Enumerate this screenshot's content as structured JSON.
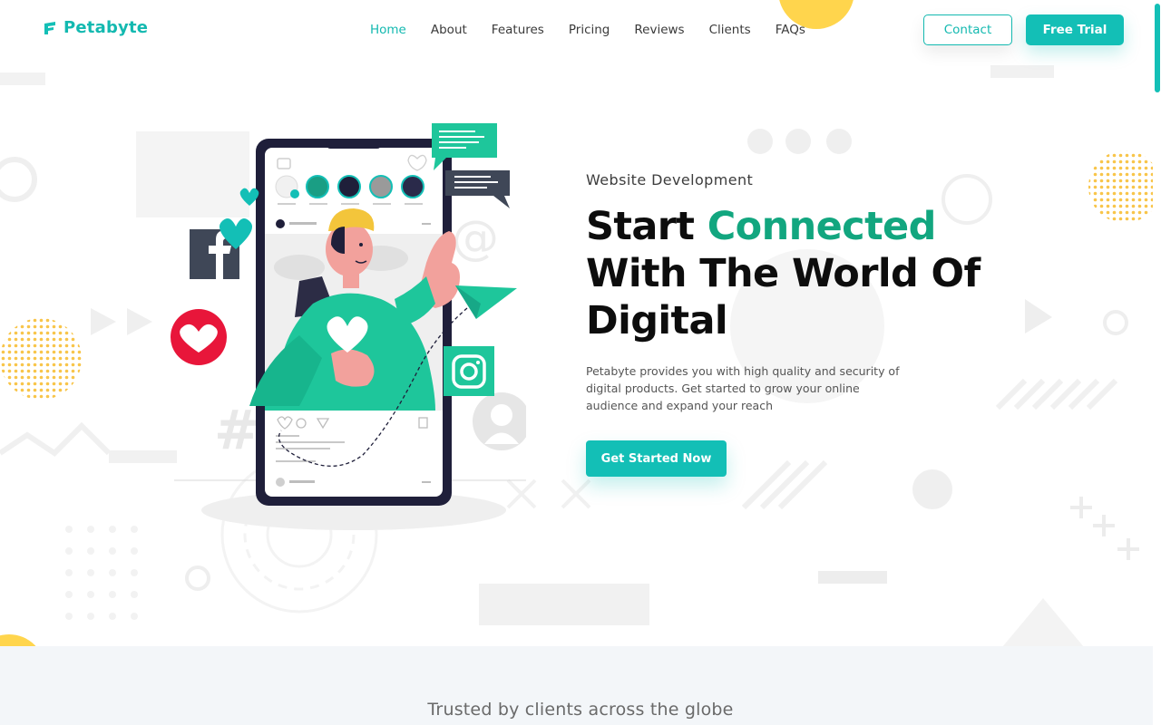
{
  "brand": {
    "name": "Petabyte"
  },
  "nav": {
    "items": [
      {
        "label": "Home",
        "active": true
      },
      {
        "label": "About",
        "active": false
      },
      {
        "label": "Features",
        "active": false
      },
      {
        "label": "Pricing",
        "active": false
      },
      {
        "label": "Reviews",
        "active": false
      },
      {
        "label": "Clients",
        "active": false
      },
      {
        "label": "FAQs",
        "active": false
      }
    ],
    "contact_label": "Contact",
    "trial_label": "Free Trial"
  },
  "hero": {
    "eyebrow": "Website Development",
    "headline_part1": "Start ",
    "headline_accent": "Connected",
    "headline_part2": "With The World Of",
    "headline_part3": "Digital",
    "description": "Petabyte provides you with high quality and security of digital products. Get started to grow your online audience and expand your reach",
    "cta_label": "Get Started Now"
  },
  "trusted": {
    "title": "Trusted by clients across the globe"
  },
  "icons": [
    "facebook-icon",
    "heart-icon",
    "instagram-icon",
    "paper-plane-icon",
    "chat-bubble-icon",
    "user-avatar-icon",
    "hashtag-icon"
  ],
  "colors": {
    "accent": "#13bfb6",
    "accent_dark": "#12a67f",
    "heart": "#e8163a",
    "phone": "#1f1f3a"
  }
}
